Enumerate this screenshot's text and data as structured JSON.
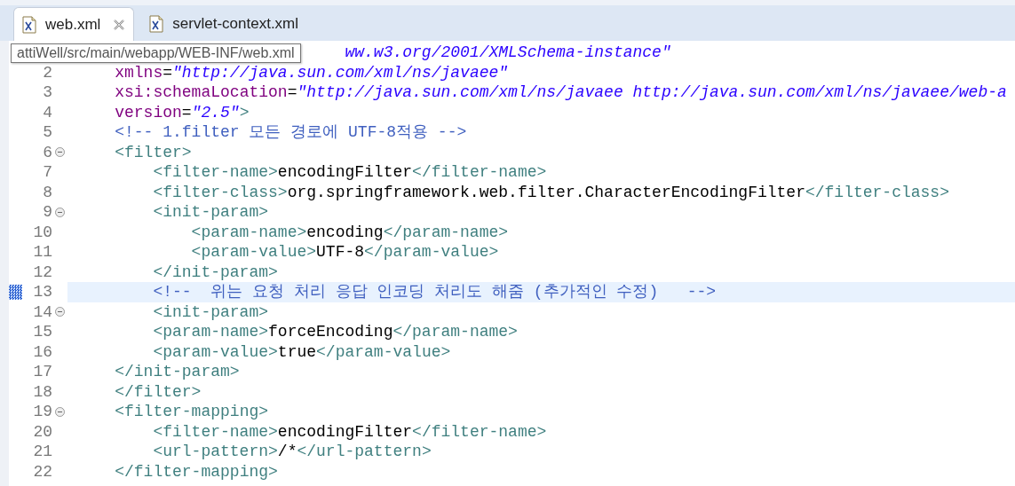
{
  "tabs": [
    {
      "label": "web.xml",
      "selected": true,
      "closable": true
    },
    {
      "label": "servlet-context.xml",
      "selected": false,
      "closable": false
    }
  ],
  "tooltip": "attiWell/src/main/webapp/WEB-INF/web.xml",
  "lines": [
    {
      "fold": false,
      "current": false,
      "tokens": [
        {
          "kind": "value",
          "text": "ww.w3.org/2001/XMLSchema-instance\""
        }
      ]
    },
    {
      "number": "2",
      "fold": false,
      "current": false,
      "tokens": [
        {
          "kind": "attr",
          "text": "xmlns"
        },
        {
          "kind": "text",
          "text": "="
        },
        {
          "kind": "value",
          "text": "\"http://java.sun.com/xml/ns/javaee\""
        }
      ]
    },
    {
      "number": "3",
      "fold": false,
      "current": false,
      "tokens": [
        {
          "kind": "attr",
          "text": "xsi:schemaLocation"
        },
        {
          "kind": "text",
          "text": "="
        },
        {
          "kind": "value",
          "text": "\"http://java.sun.com/xml/ns/javaee http://java.sun.com/xml/ns/javaee/web-a"
        }
      ]
    },
    {
      "number": "4",
      "fold": false,
      "current": false,
      "tokens": [
        {
          "kind": "attr",
          "text": "version"
        },
        {
          "kind": "text",
          "text": "="
        },
        {
          "kind": "value",
          "text": "\"2.5\""
        },
        {
          "kind": "tag",
          "text": ">"
        }
      ]
    },
    {
      "number": "5",
      "fold": false,
      "current": false,
      "tokens": [
        {
          "kind": "comment",
          "text": "<!-- 1.filter 모든 경로에 UTF-8적용 -->"
        }
      ]
    },
    {
      "number": "6",
      "fold": true,
      "current": false,
      "tokens": [
        {
          "kind": "tag",
          "text": "<filter>"
        }
      ],
      "children": [
        {
          "number": "7",
          "fold": false,
          "current": false,
          "tokens": [
            {
              "kind": "tag",
              "text": "<filter-name>"
            },
            {
              "kind": "text",
              "text": "encodingFilter"
            },
            {
              "kind": "tag",
              "text": "</filter-name>"
            }
          ]
        },
        {
          "number": "8",
          "fold": false,
          "current": false,
          "tokens": [
            {
              "kind": "tag",
              "text": "<filter-class>"
            },
            {
              "kind": "text",
              "text": "org.springframework.web.filter.CharacterEncodingFilter"
            },
            {
              "kind": "tag",
              "text": "</filter-class>"
            }
          ]
        },
        {
          "number": "9",
          "fold": true,
          "current": false,
          "tokens": [
            {
              "kind": "tag",
              "text": "<init-param>"
            }
          ],
          "children": [
            {
              "number": "10",
              "fold": false,
              "current": false,
              "tokens": [
                {
                  "kind": "tag",
                  "text": "<param-name>"
                },
                {
                  "kind": "text",
                  "text": "encoding"
                },
                {
                  "kind": "tag",
                  "text": "</param-name>"
                }
              ]
            },
            {
              "number": "11",
              "fold": false,
              "current": false,
              "tokens": [
                {
                  "kind": "tag",
                  "text": "<param-value>"
                },
                {
                  "kind": "text",
                  "text": "UTF-8"
                },
                {
                  "kind": "tag",
                  "text": "</param-value>"
                }
              ]
            }
          ]
        },
        {
          "number": "12",
          "fold": false,
          "current": false,
          "tokens": [
            {
              "kind": "tag",
              "text": "</init-param>"
            }
          ]
        },
        {
          "number": "13",
          "fold": false,
          "current": true,
          "tokens": [
            {
              "kind": "comment",
              "text": "<!--  위는 요청 처리 응답 인코딩 처리도 해줌 (추가적인 수정)   -->"
            }
          ]
        },
        {
          "number": "14",
          "fold": true,
          "current": false,
          "tokens": [
            {
              "kind": "tag",
              "text": "<init-param>"
            }
          ]
        },
        {
          "number": "15",
          "fold": false,
          "current": false,
          "tokens": [
            {
              "kind": "tag",
              "text": "<param-name>"
            },
            {
              "kind": "text",
              "text": "forceEncoding"
            },
            {
              "kind": "tag",
              "text": "</param-name>"
            }
          ]
        },
        {
          "number": "16",
          "fold": false,
          "current": false,
          "tokens": [
            {
              "kind": "tag",
              "text": "<param-value>"
            },
            {
              "kind": "text",
              "text": "true"
            },
            {
              "kind": "tag",
              "text": "</param-value>"
            }
          ]
        }
      ]
    },
    {
      "number": "17",
      "fold": false,
      "current": false,
      "tokens": [
        {
          "kind": "tag",
          "text": "</init-param>"
        }
      ]
    },
    {
      "number": "18",
      "fold": false,
      "current": false,
      "tokens": [
        {
          "kind": "tag",
          "text": "</filter>"
        }
      ]
    },
    {
      "number": "19",
      "fold": true,
      "current": false,
      "tokens": [
        {
          "kind": "tag",
          "text": "<filter-mapping>"
        }
      ],
      "children": [
        {
          "number": "20",
          "fold": false,
          "current": false,
          "tokens": [
            {
              "kind": "tag",
              "text": "<filter-name>"
            },
            {
              "kind": "text",
              "text": "encodingFilter"
            },
            {
              "kind": "tag",
              "text": "</filter-name>"
            }
          ]
        },
        {
          "number": "21",
          "fold": false,
          "current": false,
          "tokens": [
            {
              "kind": "tag",
              "text": "<url-pattern>"
            },
            {
              "kind": "text",
              "text": "/*"
            },
            {
              "kind": "tag",
              "text": "</url-pattern>"
            }
          ]
        }
      ]
    },
    {
      "number": "22",
      "fold": false,
      "current": false,
      "tokens": [
        {
          "kind": "tag",
          "text": "</filter-mapping>"
        }
      ]
    }
  ]
}
